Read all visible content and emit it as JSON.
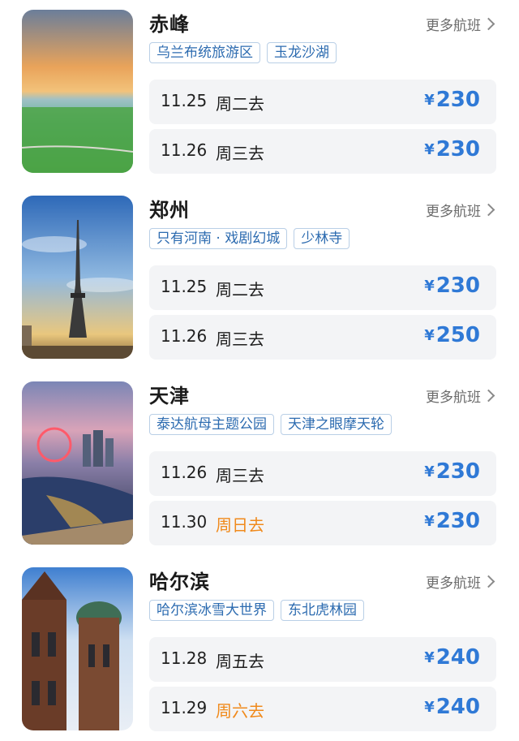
{
  "more_label": "更多航班",
  "colors": {
    "price": "#2f79d6",
    "weekend": "#f08a1c",
    "tag": "#2c6bb0"
  },
  "destinations": [
    {
      "city": "赤峰",
      "photo": "grassland-sunset-photo",
      "tags": [
        "乌兰布统旅游区",
        "玉龙沙湖"
      ],
      "flights": [
        {
          "date": "11.25",
          "day": "周二去",
          "currency": "¥",
          "price": "230"
        },
        {
          "date": "11.26",
          "day": "周三去",
          "currency": "¥",
          "price": "230"
        }
      ]
    },
    {
      "city": "郑州",
      "photo": "tv-tower-photo",
      "tags": [
        "只有河南 · 戏剧幻城",
        "少林寺"
      ],
      "flights": [
        {
          "date": "11.25",
          "day": "周二去",
          "currency": "¥",
          "price": "230"
        },
        {
          "date": "11.26",
          "day": "周三去",
          "currency": "¥",
          "price": "250"
        }
      ]
    },
    {
      "city": "天津",
      "photo": "ferris-wheel-night-photo",
      "tags": [
        "泰达航母主题公园",
        "天津之眼摩天轮"
      ],
      "flights": [
        {
          "date": "11.26",
          "day": "周三去",
          "currency": "¥",
          "price": "230"
        },
        {
          "date": "11.30",
          "day": "周日去",
          "currency": "¥",
          "price": "230"
        }
      ]
    },
    {
      "city": "哈尔滨",
      "photo": "cathedral-dome-photo",
      "tags": [
        "哈尔滨冰雪大世界",
        "东北虎林园"
      ],
      "flights": [
        {
          "date": "11.28",
          "day": "周五去",
          "currency": "¥",
          "price": "240"
        },
        {
          "date": "11.29",
          "day": "周六去",
          "currency": "¥",
          "price": "240"
        }
      ]
    }
  ]
}
